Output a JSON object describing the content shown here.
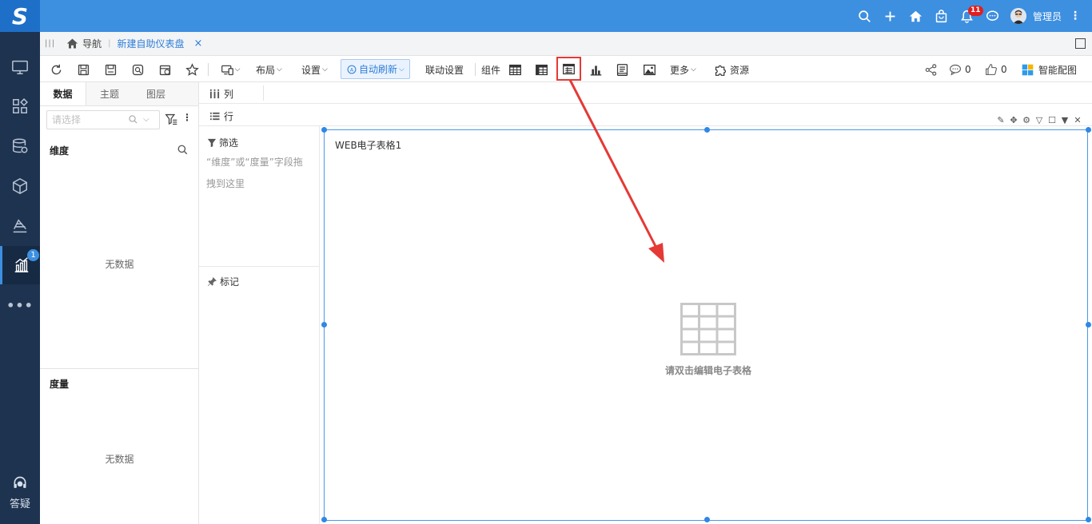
{
  "app": {
    "logo_text": "S",
    "brand_color": "#3d8fe0"
  },
  "topbar": {
    "icons": [
      "search-icon",
      "plus-icon",
      "home-icon",
      "shopping-bag-icon",
      "bell-icon",
      "chat-icon"
    ],
    "notification_count": "11",
    "user_name": "管理员",
    "more": "⋮"
  },
  "leftnav": {
    "items": [
      "monitor-icon",
      "apps-icon",
      "database-icon",
      "cube-icon",
      "analysis-icon",
      "dashboard-icon"
    ],
    "active_badge": "1",
    "more": "•••",
    "help_label": "答疑"
  },
  "tabbar": {
    "home_label": "导航",
    "active_tab": "新建自助仪表盘",
    "close": "×"
  },
  "toolbar": {
    "layout": "布局",
    "settings": "设置",
    "auto_refresh": "自动刷新",
    "link_settings": "联动设置",
    "components": "组件",
    "more": "更多",
    "resources": "资源",
    "share_icon": "share-icon",
    "comments_count": "0",
    "likes_count": "0",
    "smart_color": "智能配图"
  },
  "left_panel": {
    "tabs": [
      "数据",
      "主题",
      "图层"
    ],
    "search_placeholder": "请选择",
    "dimension_title": "维度",
    "measure_title": "度量",
    "empty_text": "无数据"
  },
  "shelves": {
    "columns_label": "列",
    "rows_label": "行",
    "filter_label": "筛选",
    "filter_hint": "“维度”或“度量”字段拖拽到这里",
    "mark_label": "标记"
  },
  "canvas": {
    "widget_title": "WEB电子表格1",
    "placeholder_text": "请双击编辑电子表格"
  }
}
